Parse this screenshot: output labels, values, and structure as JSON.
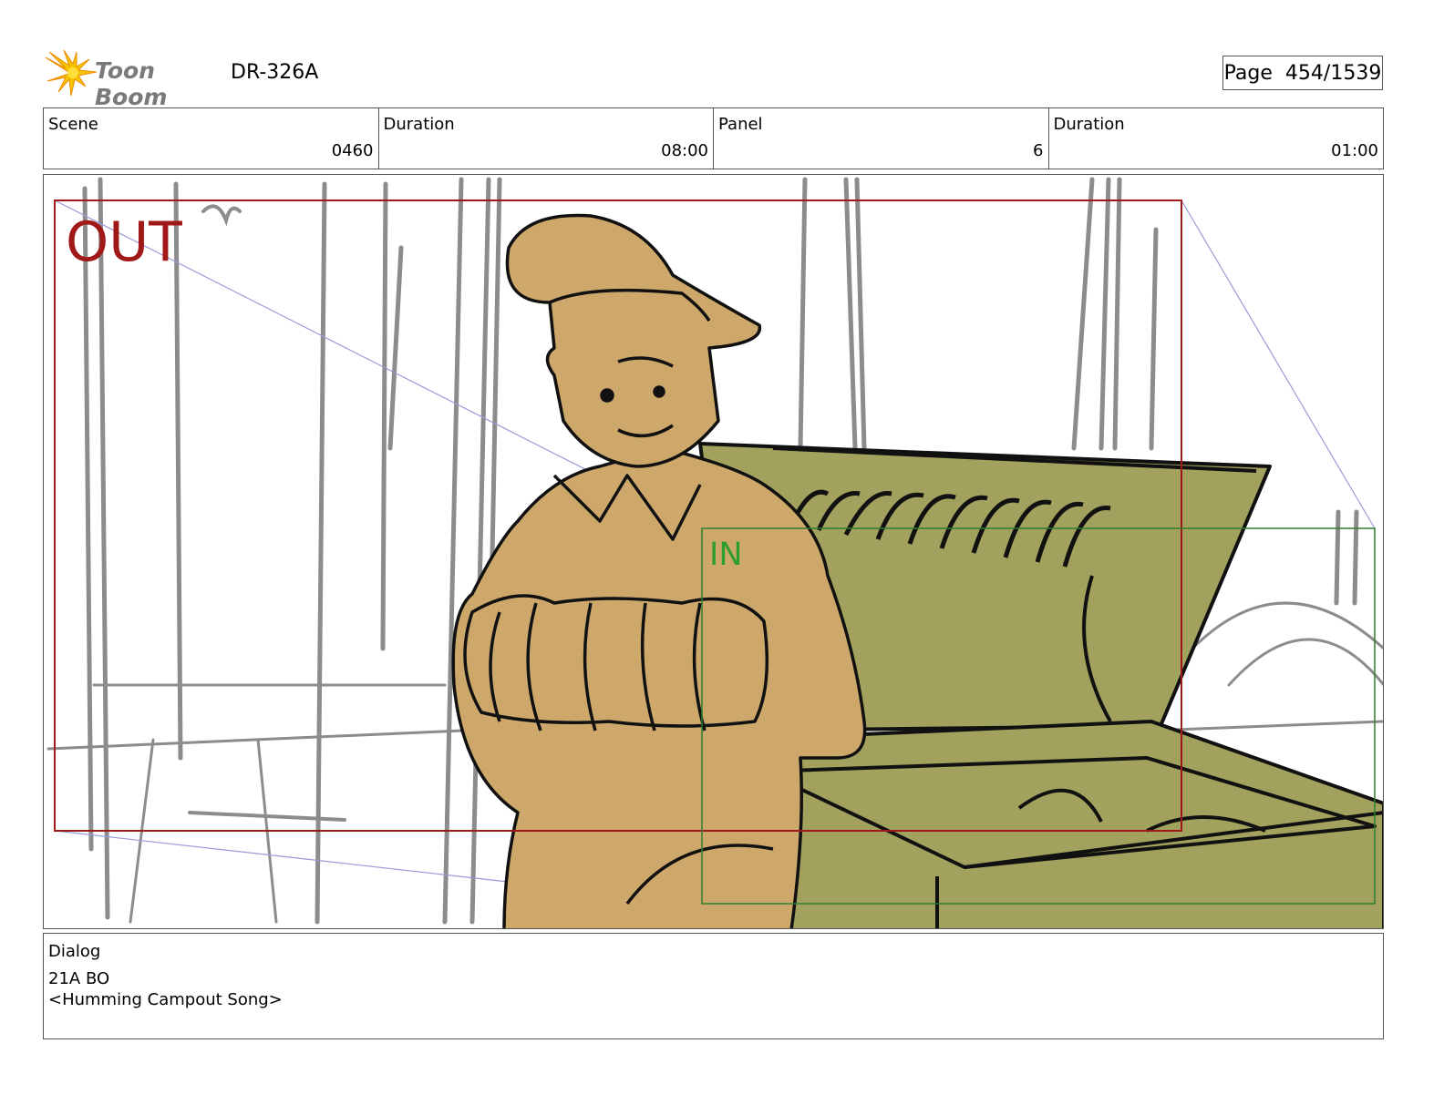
{
  "header": {
    "logo_text": "Toon Boom",
    "project_code": "DR-326A",
    "page_label": "Page",
    "page_number": "454/1539"
  },
  "info": {
    "scene_label": "Scene",
    "scene_value": "0460",
    "scene_duration_label": "Duration",
    "scene_duration_value": "08:00",
    "panel_label": "Panel",
    "panel_value": "6",
    "panel_duration_label": "Duration",
    "panel_duration_value": "01:00"
  },
  "frame": {
    "out_label": "OUT",
    "in_label": "IN",
    "colors": {
      "out_frame": "#a01818",
      "in_frame": "#2e7d2e",
      "character_fill": "#cea86b",
      "cooler_fill": "#a2a25e",
      "background_lines": "#8c8c8c"
    }
  },
  "dialog": {
    "label": "Dialog",
    "line1": "21A BO",
    "line2": "<Humming Campout Song>"
  }
}
